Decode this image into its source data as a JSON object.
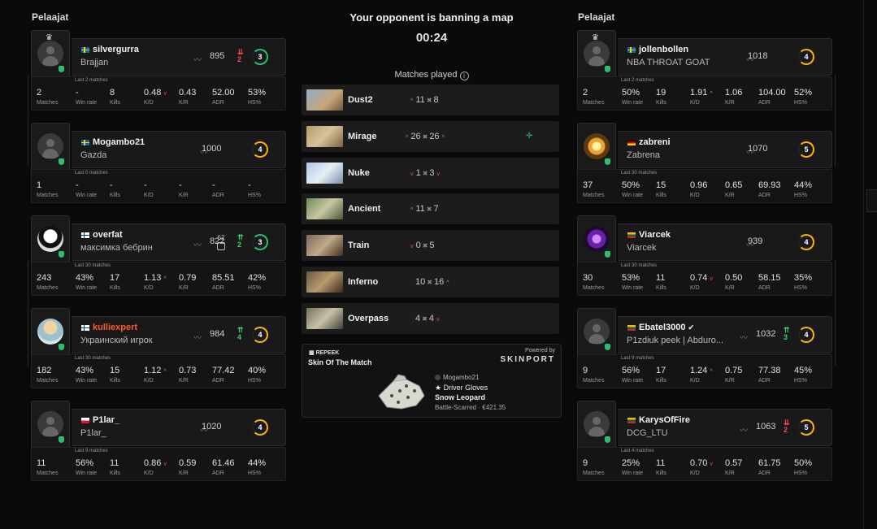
{
  "left_team": {
    "title": "Pelaajat",
    "players": [
      {
        "nick": "silvergurra",
        "real": "Brajjan",
        "elo": "895",
        "change": "2",
        "change_dir": "down",
        "level": "3",
        "level_color": "green",
        "period": "Last 2 matches",
        "stats": {
          "matches": "2",
          "win_rate": "-",
          "kills": "8",
          "kd": "0.48",
          "kd_dir": "down",
          "kr": "0.43",
          "adr": "52.00",
          "hs": "53%"
        },
        "crown": true
      },
      {
        "nick": "Mogambo21",
        "real": "Gazda",
        "elo": "1000",
        "change": "",
        "change_dir": "",
        "level": "4",
        "level_color": "yellow",
        "period": "Last 0 matches",
        "stats": {
          "matches": "1",
          "win_rate": "-",
          "kills": "-",
          "kd": "-",
          "kd_dir": "",
          "kr": "-",
          "adr": "-",
          "hs": "-"
        },
        "crown": false
      },
      {
        "nick": "overfat",
        "real": "максимка бебрин",
        "elo": "822",
        "change": "2",
        "change_dir": "up",
        "level": "3",
        "level_color": "green",
        "badge": "62",
        "period": "Last 30 matches",
        "stats": {
          "matches": "243",
          "win_rate": "43%",
          "kills": "17",
          "kd": "1.13",
          "kd_dir": "up",
          "kr": "0.79",
          "adr": "85.51",
          "hs": "42%"
        },
        "crown": false
      },
      {
        "nick": "kulliexpert",
        "real": "Украинский игрок",
        "elo": "984",
        "change": "4",
        "change_dir": "up",
        "level": "4",
        "level_color": "yellow",
        "period": "Last 30 matches",
        "stats": {
          "matches": "182",
          "win_rate": "43%",
          "kills": "15",
          "kd": "1.12",
          "kd_dir": "up",
          "kr": "0.73",
          "adr": "77.42",
          "hs": "40%"
        },
        "crown": false
      },
      {
        "nick": "P1lar_",
        "real": "P1lar_",
        "elo": "1020",
        "change": "",
        "change_dir": "",
        "level": "4",
        "level_color": "yellow",
        "period": "Last 9 matches",
        "stats": {
          "matches": "11",
          "win_rate": "56%",
          "kills": "11",
          "kd": "0.86",
          "kd_dir": "down",
          "kr": "0.59",
          "adr": "61.46",
          "hs": "44%"
        },
        "crown": false
      }
    ]
  },
  "right_team": {
    "title": "Pelaajat",
    "players": [
      {
        "nick": "jollenbollen",
        "real": "NBA THROAT GOAT",
        "elo": "1018",
        "change": "",
        "change_dir": "",
        "level": "4",
        "level_color": "yellow",
        "period": "Last 2 matches",
        "stats": {
          "matches": "2",
          "win_rate": "50%",
          "kills": "19",
          "kd": "1.91",
          "kd_dir": "up",
          "kr": "1.06",
          "adr": "104.00",
          "hs": "52%"
        },
        "crown": true
      },
      {
        "nick": "zabreni",
        "real": "Zabrena",
        "elo": "1070",
        "change": "",
        "change_dir": "",
        "level": "5",
        "level_color": "yellow",
        "period": "Last 30 matches",
        "stats": {
          "matches": "37",
          "win_rate": "50%",
          "kills": "15",
          "kd": "0.96",
          "kd_dir": "",
          "kr": "0.65",
          "adr": "69.93",
          "hs": "44%"
        },
        "crown": false
      },
      {
        "nick": "Viarcek",
        "real": "Viarcek",
        "elo": "939",
        "change": "",
        "change_dir": "",
        "level": "4",
        "level_color": "yellow",
        "period": "Last 30 matches",
        "stats": {
          "matches": "30",
          "win_rate": "53%",
          "kills": "11",
          "kd": "0.74",
          "kd_dir": "down",
          "kr": "0.50",
          "adr": "58.15",
          "hs": "35%"
        },
        "crown": false
      },
      {
        "nick": "Ebatel3000",
        "real": "P1zdiuk peek | Abduro...",
        "elo": "1032",
        "change": "3",
        "change_dir": "up",
        "level": "4",
        "level_color": "yellow",
        "period": "Last 9 matches",
        "stats": {
          "matches": "9",
          "win_rate": "56%",
          "kills": "17",
          "kd": "1.24",
          "kd_dir": "up",
          "kr": "0.75",
          "adr": "77.38",
          "hs": "45%"
        },
        "crown": false,
        "verified": true
      },
      {
        "nick": "KarysOfFire",
        "real": "DCG_LTU",
        "elo": "1063",
        "change": "2",
        "change_dir": "down",
        "level": "5",
        "level_color": "yellow",
        "period": "Last 4 matches",
        "stats": {
          "matches": "9",
          "win_rate": "25%",
          "kills": "11",
          "kd": "0.70",
          "kd_dir": "down",
          "kr": "0.57",
          "adr": "61.75",
          "hs": "50%"
        },
        "crown": false
      }
    ]
  },
  "stat_labels": {
    "matches": "Matches",
    "win_rate": "Win rate",
    "kills": "Kills",
    "kd": "K/D",
    "kr": "K/R",
    "adr": "ADR",
    "hs": "HS%"
  },
  "center": {
    "banner": "Your opponent is banning a map",
    "timer": "00:24",
    "matches_played": "Matches played",
    "maps": [
      {
        "name": "Dust2",
        "left": "11",
        "right": "8",
        "left_dir": "up",
        "right_dir": ""
      },
      {
        "name": "Mirage",
        "left": "26",
        "right": "26",
        "left_dir": "up",
        "right_dir": "up",
        "selected": true
      },
      {
        "name": "Nuke",
        "left": "1",
        "right": "3",
        "left_dir": "down",
        "right_dir": "down"
      },
      {
        "name": "Ancient",
        "left": "11",
        "right": "7",
        "left_dir": "up",
        "right_dir": ""
      },
      {
        "name": "Train",
        "left": "0",
        "right": "5",
        "left_dir": "down",
        "right_dir": ""
      },
      {
        "name": "Inferno",
        "left": "10",
        "right": "16",
        "left_dir": "",
        "right_dir": "up"
      },
      {
        "name": "Overpass",
        "left": "4",
        "right": "4",
        "left_dir": "",
        "right_dir": "down"
      }
    ],
    "skin": {
      "brand": "REPEEK",
      "title": "Skin Of The Match",
      "powered": "Powered by",
      "sponsor": "SKINPORT",
      "owner": "Mogambo21",
      "item1": "★ Driver Gloves",
      "item2": "Snow Leopard",
      "condition": "Battle-Scarred · €421.35"
    }
  },
  "colors": {
    "up": "#3fd06a",
    "down": "#ff4a4a",
    "level_yellow": "#ffb400",
    "level_green": "#2ac06a",
    "accent_red": "#ff5a2c"
  }
}
